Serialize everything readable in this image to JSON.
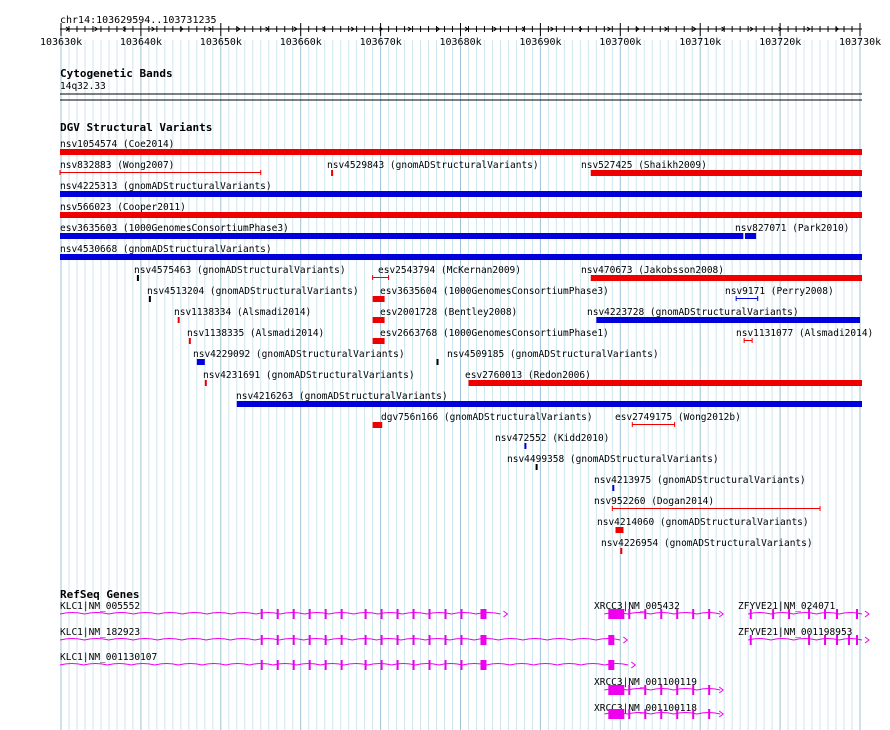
{
  "ruler": {
    "range_label": "chr14:103629594..103731235",
    "ticks": [
      {
        "label": "103630k",
        "pos": 103630000
      },
      {
        "label": "103640k",
        "pos": 103640000
      },
      {
        "label": "103650k",
        "pos": 103650000
      },
      {
        "label": "103660k",
        "pos": 103660000
      },
      {
        "label": "103670k",
        "pos": 103670000
      },
      {
        "label": "103680k",
        "pos": 103680000
      },
      {
        "label": "103690k",
        "pos": 103690000
      },
      {
        "label": "103700k",
        "pos": 103700000
      },
      {
        "label": "103710k",
        "pos": 103710000
      },
      {
        "label": "103720k",
        "pos": 103720000
      },
      {
        "label": "103730k",
        "pos": 103730000
      }
    ]
  },
  "cytobands": {
    "title": "Cytogenetic Bands",
    "band": "14q32.33"
  },
  "dgv": {
    "title": "DGV Structural Variants",
    "colors": {
      "red": "#ee0000",
      "blue": "#0000dd",
      "bar": "#ff0000"
    },
    "variants": [
      {
        "label": "nsv1054574 (Coe2014)",
        "color": "red",
        "start": 103629594,
        "end": 103731235
      },
      {
        "label": "nsv832883 (Wong2007)",
        "color": "red",
        "style": "bracket",
        "start": 103629594,
        "end": 103655000
      },
      {
        "label": "nsv4529843 (gnomADStructuralVariants)",
        "color": "red",
        "start": 103663800,
        "end": 103664000
      },
      {
        "label": "nsv527425 (Shaikh2009)",
        "color": "red",
        "start": 103696300,
        "end": 103731235
      },
      {
        "label": "nsv4225313 (gnomADStructuralVariants)",
        "color": "blue",
        "start": 103629594,
        "end": 103731235
      },
      {
        "label": "nsv566023 (Cooper2011)",
        "color": "red",
        "start": 103629594,
        "end": 103731235
      },
      {
        "label": "esv3635603 (1000GenomesConsortiumPhase3)",
        "color": "blue",
        "start": 103629594,
        "end": 103715400
      },
      {
        "label": "nsv827071 (Park2010)",
        "color": "blue",
        "start": 103715600,
        "end": 103717000
      },
      {
        "label": "nsv4530668 (gnomADStructuralVariants)",
        "color": "blue",
        "start": 103629594,
        "end": 103731235
      },
      {
        "label": "nsv4575463 (gnomADStructuralVariants)",
        "color": "black",
        "start": 103639500,
        "end": 103639600
      },
      {
        "label": "esv2543794 (McKernan2009)",
        "color": "red",
        "style": "bracket",
        "start": 103669000,
        "end": 103671000
      },
      {
        "label": "nsv470673 (Jakobsson2008)",
        "color": "red",
        "start": 103696300,
        "end": 103731235
      },
      {
        "label": "nsv4513204 (gnomADStructuralVariants)",
        "color": "black",
        "start": 103641000,
        "end": 103641100
      },
      {
        "label": "esv3635604 (1000GenomesConsortiumPhase3)",
        "color": "red",
        "start": 103669000,
        "end": 103670500
      },
      {
        "label": "nsv9171 (Perry2008)",
        "color": "blue",
        "style": "bracket",
        "start": 103714500,
        "end": 103717200
      },
      {
        "label": "nsv1138334 (Alsmadi2014)",
        "color": "red",
        "start": 103644600,
        "end": 103644800
      },
      {
        "label": "esv2001728 (Bentley2008)",
        "color": "red",
        "start": 103669000,
        "end": 103670500
      },
      {
        "label": "nsv4223728 (gnomADStructuralVariants)",
        "color": "blue",
        "start": 103697000,
        "end": 103730000
      },
      {
        "label": "nsv1138335 (Alsmadi2014)",
        "color": "red",
        "start": 103646000,
        "end": 103646200
      },
      {
        "label": "esv2663768 (1000GenomesConsortiumPhase1)",
        "color": "red",
        "start": 103669000,
        "end": 103670500
      },
      {
        "label": "nsv1131077 (Alsmadi2014)",
        "color": "red",
        "style": "bracket",
        "start": 103715500,
        "end": 103716500
      },
      {
        "label": "nsv4229092 (gnomADStructuralVariants)",
        "color": "blue",
        "start": 103647000,
        "end": 103648000
      },
      {
        "label": "nsv4509185 (gnomADStructuralVariants)",
        "color": "black",
        "start": 103677000,
        "end": 103677100
      },
      {
        "label": "nsv4231691 (gnomADStructuralVariants)",
        "color": "red",
        "start": 103648000,
        "end": 103648200
      },
      {
        "label": "esv2760013 (Redon2006)",
        "color": "red",
        "start": 103681000,
        "end": 103731235
      },
      {
        "label": "nsv4216263 (gnomADStructuralVariants)",
        "color": "blue",
        "start": 103652000,
        "end": 103731235
      },
      {
        "label": "dgv756n166 (gnomADStructuralVariants)",
        "color": "red",
        "start": 103669000,
        "end": 103670200
      },
      {
        "label": "esv2749175 (Wong2012b)",
        "color": "red",
        "style": "bracket",
        "start": 103701500,
        "end": 103706800
      },
      {
        "label": "nsv472552 (Kidd2010)",
        "color": "blue",
        "start": 103688000,
        "end": 103688100
      },
      {
        "label": "nsv4499358 (gnomADStructuralVariants)",
        "color": "black",
        "start": 103689400,
        "end": 103689500
      },
      {
        "label": "nsv4213975 (gnomADStructuralVariants)",
        "color": "blue",
        "start": 103699000,
        "end": 103699100
      },
      {
        "label": "nsv952260 (Dogan2014)",
        "color": "red",
        "style": "bracket",
        "start": 103699000,
        "end": 103725000
      },
      {
        "label": "nsv4214060 (gnomADStructuralVariants)",
        "color": "red",
        "start": 103699400,
        "end": 103700400
      },
      {
        "label": "nsv4226954 (gnomADStructuralVariants)",
        "color": "red",
        "start": 103700000,
        "end": 103700200
      }
    ]
  },
  "refseq": {
    "title": "RefSeq Genes",
    "color": "#ee00ee",
    "genes": [
      {
        "label": "KLC1|NM_005552",
        "start": 103629594,
        "end": 103685000,
        "exons": [
          103655000,
          103657000,
          103659000,
          103661000,
          103663000,
          103665000,
          103668000,
          103670000,
          103672000,
          103674000,
          103676000,
          103678000,
          103680000,
          103682500
        ],
        "strand": "+"
      },
      {
        "label": "KLC1|NM_182923",
        "start": 103629594,
        "end": 103700000,
        "exons": [
          103655000,
          103657000,
          103659000,
          103661000,
          103663000,
          103665000,
          103668000,
          103670000,
          103672000,
          103674000,
          103676000,
          103678000,
          103680000,
          103682500,
          103698500
        ],
        "strand": "+"
      },
      {
        "label": "KLC1|NM_001130107",
        "start": 103629594,
        "end": 103701000,
        "exons": [
          103655000,
          103657000,
          103659000,
          103661000,
          103663000,
          103665000,
          103668000,
          103670000,
          103672000,
          103674000,
          103676000,
          103678000,
          103680000,
          103682500,
          103698500
        ],
        "strand": "+"
      },
      {
        "label": "XRCC3|NM_005432",
        "start": 103698000,
        "end": 103712500,
        "exons": [
          103698500,
          103701000,
          103703000,
          103705000,
          103707000,
          103709000,
          103711000
        ],
        "strand": "-"
      },
      {
        "label": "ZFYVE21|NM_024071",
        "start": 103716000,
        "end": 103731000,
        "exons": [
          103716200,
          103719000,
          103721000,
          103723500,
          103725500,
          103727000,
          103729500
        ],
        "strand": "+"
      },
      {
        "label": "ZFYVE21|NM_001198953",
        "start": 103716000,
        "end": 103731000,
        "exons": [
          103716200,
          103723500,
          103725500,
          103727000,
          103728500,
          103729500
        ],
        "strand": "+"
      },
      {
        "label": "XRCC3|NM_001100119",
        "start": 103698000,
        "end": 103712500,
        "exons": [
          103698500,
          103701000,
          103703000,
          103705000,
          103707000,
          103709000,
          103711000
        ],
        "strand": "-"
      },
      {
        "label": "XRCC3|NM_001100118",
        "start": 103698000,
        "end": 103712500,
        "exons": [
          103698500,
          103701000,
          103703000,
          103705000,
          103707000,
          103709000,
          103711000
        ],
        "strand": "-"
      }
    ]
  }
}
